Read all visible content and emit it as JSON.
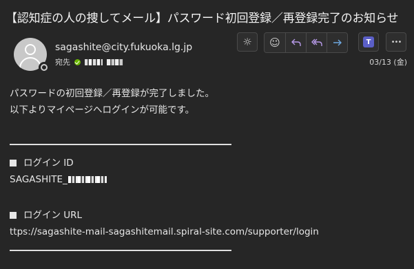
{
  "email": {
    "subject": "【認知症の人の捜してメール】パスワード初回登録／再登録完了のお知らせ",
    "sender": "sagashite@city.fukuoka.lg.jp",
    "to_label": "宛先",
    "date": "03/13 (金)"
  },
  "toolbar": {
    "icons": [
      "brightness-icon",
      "emoji-react-icon",
      "reply-icon",
      "reply-all-icon",
      "forward-icon",
      "teams-icon",
      "more-icon"
    ],
    "teams_label": "T",
    "more_label": "•••"
  },
  "body": {
    "line1": "パスワードの初回登録／再登録が完了しました。",
    "line2": "以下よりマイページへログインが可能です。",
    "login_id_label": "ログイン ID",
    "login_id_value": "SAGASHITE_",
    "login_url_label": "ログイン URL",
    "login_url_value": "ttps://sagashite-mail-sagashitemail.spiral-site.com/supporter/login"
  },
  "colors": {
    "background": "#262626",
    "text": "#e6e6e6",
    "reply_accent": "#b79ae8",
    "forward_accent": "#6fa8e0",
    "teams": "#5b5fc7",
    "presence_ok": "#6bb700"
  }
}
